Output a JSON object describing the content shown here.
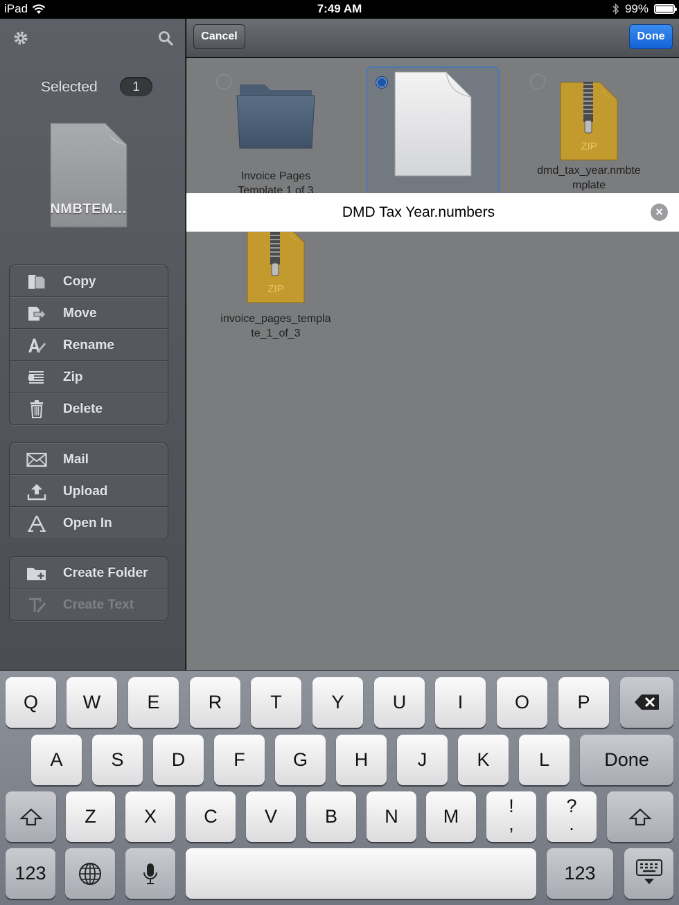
{
  "status_bar": {
    "device": "iPad",
    "time": "7:49 AM",
    "battery": "99%",
    "battery_level": 0.99,
    "icons": [
      "wifi-icon",
      "bluetooth-icon",
      "battery-icon"
    ]
  },
  "sidebar": {
    "settings_icon": "gear-icon",
    "search_icon": "search-icon",
    "selected_label": "Selected",
    "selected_count": "1",
    "thumbnail_label": "NMBTEM…",
    "groups": [
      [
        {
          "label": "Copy",
          "icon": "copy-icon",
          "enabled": true
        },
        {
          "label": "Move",
          "icon": "move-icon",
          "enabled": true
        },
        {
          "label": "Rename",
          "icon": "rename-icon",
          "enabled": true
        },
        {
          "label": "Zip",
          "icon": "zip-icon",
          "enabled": true
        },
        {
          "label": "Delete",
          "icon": "trash-icon",
          "enabled": true
        }
      ],
      [
        {
          "label": "Mail",
          "icon": "mail-icon",
          "enabled": true
        },
        {
          "label": "Upload",
          "icon": "upload-icon",
          "enabled": true
        },
        {
          "label": "Open In",
          "icon": "open-in-icon",
          "enabled": true
        }
      ],
      [
        {
          "label": "Create Folder",
          "icon": "create-folder-icon",
          "enabled": true
        },
        {
          "label": "Create Text",
          "icon": "create-text-icon",
          "enabled": false
        }
      ]
    ]
  },
  "toolbar": {
    "cancel_label": "Cancel",
    "done_label": "Done"
  },
  "files": [
    {
      "name": "Invoice Pages Template 1 of 3",
      "line1": "Invoice Pages",
      "line2": "Template 1 of 3",
      "type": "folder",
      "selected": false
    },
    {
      "name": "",
      "type": "document",
      "selected": true
    },
    {
      "name": "dmd_tax_year.nmbtemplate",
      "line1": "dmd_tax_year.nmbte",
      "line2": "mplate",
      "type": "zip",
      "zip_label": "ZIP",
      "selected": false
    },
    {
      "name": "invoice_pages_template_1_of_3",
      "line1": "invoice_pages_templa",
      "line2": "te_1_of_3",
      "type": "zip",
      "zip_label": "ZIP",
      "selected": false
    }
  ],
  "rename": {
    "value": "DMD Tax Year.numbers",
    "clear_icon": "clear-icon"
  },
  "keyboard": {
    "row1": [
      "Q",
      "W",
      "E",
      "R",
      "T",
      "Y",
      "U",
      "I",
      "O",
      "P"
    ],
    "row2": [
      "A",
      "S",
      "D",
      "F",
      "G",
      "H",
      "J",
      "K",
      "L"
    ],
    "row3": [
      "Z",
      "X",
      "C",
      "V",
      "B",
      "N",
      "M"
    ],
    "punct1": [
      "!",
      ","
    ],
    "punct2": [
      "?",
      "."
    ],
    "done_label": "Done",
    "numbers_label": "123",
    "icons": [
      "backspace-icon",
      "shift-icon",
      "globe-icon",
      "microphone-icon",
      "hide-keyboard-icon"
    ]
  }
}
